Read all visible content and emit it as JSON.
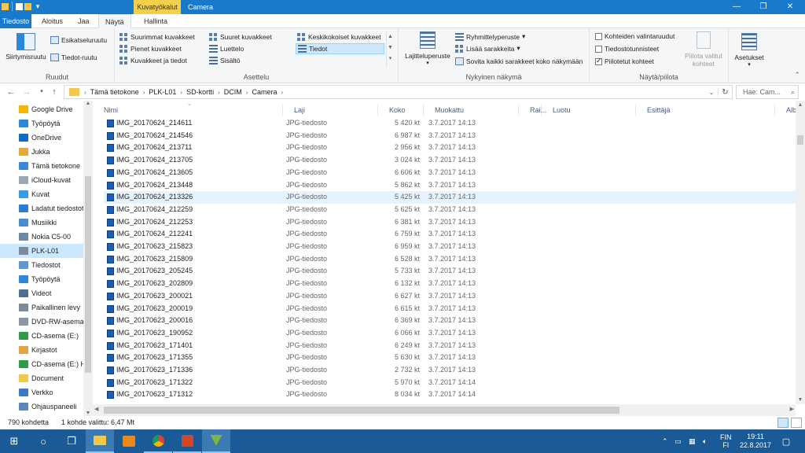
{
  "titlebar": {
    "contextual_tab_header": "Kuvatyökalut",
    "window_title": "Camera",
    "controls": [
      "minimize",
      "maximize",
      "close"
    ],
    "accent_color": "#1979ca"
  },
  "tabs": [
    "Tiedosto",
    "Aloitus",
    "Jaa",
    "Näytä",
    "Hallinta"
  ],
  "ribbon": {
    "panes": {
      "label": "Ruudut",
      "navigation_pane": "Siirtymisruutu",
      "preview_pane": "Esikatseluruutu",
      "details_pane": "Tiedot-ruutu"
    },
    "layout": {
      "label": "Asettelu",
      "options": [
        "Suurimmat kuvakkeet",
        "Suuret kuvakkeet",
        "Keskikokoiset kuvakkeet",
        "Pienet kuvakkeet",
        "Luettelo",
        "Tiedot",
        "Kuvakkeet ja tiedot",
        "Sisältö"
      ],
      "selected": "Tiedot"
    },
    "current_view": {
      "label": "Nykyinen näkymä",
      "sort_by": "Lajitteluperuste",
      "group_by": "Ryhmittelyperuste",
      "add_columns": "Lisää sarakkeita",
      "fit_columns": "Sovita kaikki sarakkeet koko näkymään"
    },
    "show_hide": {
      "label": "Näytä/piilota",
      "item_checkboxes": "Kohteiden valintaruudut",
      "file_extensions": "Tiedostotunnisteet",
      "hidden_items": "Piilotetut kohteet",
      "hidden_items_checked": true,
      "hide_selected_line1": "Piilota valitut",
      "hide_selected_line2": "kohteet"
    },
    "options": "Asetukset"
  },
  "address": {
    "crumbs": [
      "Tämä tietokone",
      "PLK-L01",
      "SD-kortti",
      "DCIM",
      "Camera"
    ],
    "search_placeholder": "Hae: Cam..."
  },
  "nav": [
    {
      "label": "Google Drive",
      "icon": "google-drive-icon",
      "color": "#f4b400"
    },
    {
      "label": "Työpöytä",
      "icon": "desktop-icon",
      "color": "#2b88d8"
    },
    {
      "label": "OneDrive",
      "icon": "cloud-icon",
      "color": "#0f6cbd"
    },
    {
      "label": "Jukka",
      "icon": "user-icon",
      "color": "#e5a83b"
    },
    {
      "label": "Tämä tietokone",
      "icon": "computer-icon",
      "color": "#3a88d6"
    },
    {
      "label": "iCloud-kuvat",
      "icon": "icloud-icon",
      "color": "#9aa7b4"
    },
    {
      "label": "Kuvat",
      "icon": "pictures-icon",
      "color": "#3b9ae1"
    },
    {
      "label": "Ladatut tiedostot",
      "icon": "download-icon",
      "color": "#2e7bcf"
    },
    {
      "label": "Musiikki",
      "icon": "music-icon",
      "color": "#4a8ad0"
    },
    {
      "label": "Nokia C5-00",
      "icon": "phone-icon",
      "color": "#6b89a8"
    },
    {
      "label": "PLK-L01",
      "icon": "device-icon",
      "color": "#7c8a99"
    },
    {
      "label": "Tiedostot",
      "icon": "documents-icon",
      "color": "#5e97d1"
    },
    {
      "label": "Työpöytä",
      "icon": "desktop-icon",
      "color": "#2b88d8"
    },
    {
      "label": "Videot",
      "icon": "videos-icon",
      "color": "#4f6f8f"
    },
    {
      "label": "Paikallinen levy",
      "icon": "drive-icon",
      "color": "#7d8a97"
    },
    {
      "label": "DVD-RW-asema",
      "icon": "dvd-icon",
      "color": "#8a96a3"
    },
    {
      "label": "CD-asema (E:)",
      "icon": "cd-icon",
      "color": "#2e9a4a"
    },
    {
      "label": "Kirjastot",
      "icon": "libraries-icon",
      "color": "#e3a33e"
    },
    {
      "label": "CD-asema (E:) H",
      "icon": "cd-icon",
      "color": "#2e9a4a"
    },
    {
      "label": "Document",
      "icon": "folder-icon",
      "color": "#f3c74b"
    },
    {
      "label": "Verkko",
      "icon": "network-icon",
      "color": "#3a7cc2"
    },
    {
      "label": "Ohjauspaneeli",
      "icon": "control-panel-icon",
      "color": "#5b87b8"
    }
  ],
  "nav_selected_index": 10,
  "columns": [
    "Nimi",
    "Laji",
    "Koko",
    "Muokattu",
    "Rai...",
    "Luotu",
    "Esittäjä",
    "Albu"
  ],
  "files": [
    {
      "name": "IMG_20170624_214611",
      "type": "JPG-tiedosto",
      "size": "5 420 kt",
      "modified": "3.7.2017 14:13"
    },
    {
      "name": "IMG_20170624_214546",
      "type": "JPG-tiedosto",
      "size": "6 987 kt",
      "modified": "3.7.2017 14:13"
    },
    {
      "name": "IMG_20170624_213711",
      "type": "JPG-tiedosto",
      "size": "2 956 kt",
      "modified": "3.7.2017 14:13"
    },
    {
      "name": "IMG_20170624_213705",
      "type": "JPG-tiedosto",
      "size": "3 024 kt",
      "modified": "3.7.2017 14:13"
    },
    {
      "name": "IMG_20170624_213605",
      "type": "JPG-tiedosto",
      "size": "6 606 kt",
      "modified": "3.7.2017 14:13"
    },
    {
      "name": "IMG_20170624_213448",
      "type": "JPG-tiedosto",
      "size": "5 862 kt",
      "modified": "3.7.2017 14:13"
    },
    {
      "name": "IMG_20170624_213326",
      "type": "JPG-tiedosto",
      "size": "5 425 kt",
      "modified": "3.7.2017 14:13"
    },
    {
      "name": "IMG_20170624_212259",
      "type": "JPG-tiedosto",
      "size": "5 625 kt",
      "modified": "3.7.2017 14:13"
    },
    {
      "name": "IMG_20170624_212253",
      "type": "JPG-tiedosto",
      "size": "6 381 kt",
      "modified": "3.7.2017 14:13"
    },
    {
      "name": "IMG_20170624_212241",
      "type": "JPG-tiedosto",
      "size": "6 759 kt",
      "modified": "3.7.2017 14:13"
    },
    {
      "name": "IMG_20170623_215823",
      "type": "JPG-tiedosto",
      "size": "6 959 kt",
      "modified": "3.7.2017 14:13"
    },
    {
      "name": "IMG_20170623_215809",
      "type": "JPG-tiedosto",
      "size": "6 528 kt",
      "modified": "3.7.2017 14:13"
    },
    {
      "name": "IMG_20170623_205245",
      "type": "JPG-tiedosto",
      "size": "5 733 kt",
      "modified": "3.7.2017 14:13"
    },
    {
      "name": "IMG_20170623_202809",
      "type": "JPG-tiedosto",
      "size": "6 132 kt",
      "modified": "3.7.2017 14:13"
    },
    {
      "name": "IMG_20170623_200021",
      "type": "JPG-tiedosto",
      "size": "6 627 kt",
      "modified": "3.7.2017 14:13"
    },
    {
      "name": "IMG_20170623_200019",
      "type": "JPG-tiedosto",
      "size": "6 615 kt",
      "modified": "3.7.2017 14:13"
    },
    {
      "name": "IMG_20170623_200016",
      "type": "JPG-tiedosto",
      "size": "6 369 kt",
      "modified": "3.7.2017 14:13"
    },
    {
      "name": "IMG_20170623_190952",
      "type": "JPG-tiedosto",
      "size": "6 066 kt",
      "modified": "3.7.2017 14:13"
    },
    {
      "name": "IMG_20170623_171401",
      "type": "JPG-tiedosto",
      "size": "6 249 kt",
      "modified": "3.7.2017 14:13"
    },
    {
      "name": "IMG_20170623_171355",
      "type": "JPG-tiedosto",
      "size": "5 630 kt",
      "modified": "3.7.2017 14:13"
    },
    {
      "name": "IMG_20170623_171336",
      "type": "JPG-tiedosto",
      "size": "2 732 kt",
      "modified": "3.7.2017 14:13"
    },
    {
      "name": "IMG_20170623_171322",
      "type": "JPG-tiedosto",
      "size": "5 970 kt",
      "modified": "3.7.2017 14:14"
    },
    {
      "name": "IMG_20170623_171312",
      "type": "JPG-tiedosto",
      "size": "8 034 kt",
      "modified": "3.7.2017 14:14"
    }
  ],
  "selected_file_index": 6,
  "status": {
    "count": "790 kohdetta",
    "selection": "1 kohde valittu: 6,47 Mt"
  },
  "taskbar": {
    "apps": [
      "start-icon",
      "search-icon",
      "task-view-icon",
      "file-explorer-icon",
      "media-player-icon",
      "chrome-icon",
      "powerpoint-icon",
      "app-icon"
    ],
    "language_line1": "FIN",
    "language_line2": "FI",
    "time": "19:11",
    "date": "22.8.2017",
    "color": "#1a5a96"
  }
}
